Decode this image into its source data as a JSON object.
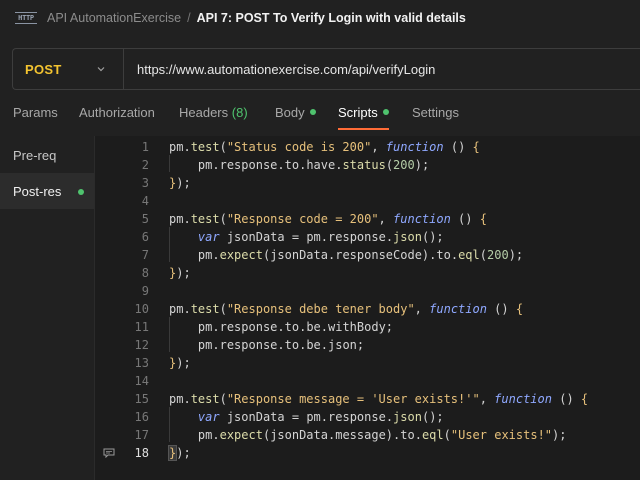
{
  "header": {
    "http_icon_text": "HTTP",
    "collection_name": "API AutomationExercise",
    "separator": "/",
    "request_name": "API 7: POST To Verify Login with valid details"
  },
  "request": {
    "method": "POST",
    "url": "https://www.automationexercise.com/api/verifyLogin"
  },
  "tabs": [
    {
      "label": "Params"
    },
    {
      "label": "Authorization"
    },
    {
      "label": "Headers",
      "count": "(8)"
    },
    {
      "label": "Body"
    },
    {
      "label": "Scripts"
    },
    {
      "label": "Settings"
    }
  ],
  "active_tab": "Scripts",
  "scripts_panel": {
    "items": [
      {
        "label": "Pre-req"
      },
      {
        "label": "Post-res"
      }
    ],
    "active": "Post-res"
  },
  "editor": {
    "current_line": 18,
    "line_numbers": [
      "1",
      "2",
      "3",
      "4",
      "5",
      "6",
      "7",
      "8",
      "9",
      "10",
      "11",
      "12",
      "13",
      "14",
      "15",
      "16",
      "17",
      "18"
    ],
    "lines": [
      "pm.test(\"Status code is 200\", function () {",
      "    pm.response.to.have.status(200);",
      "});",
      "",
      "pm.test(\"Response code = 200\", function () {",
      "    var jsonData = pm.response.json();",
      "    pm.expect(jsonData.responseCode).to.eql(200);",
      "});",
      "",
      "pm.test(\"Response debe tener body\", function () {",
      "    pm.response.to.be.withBody;",
      "    pm.response.to.be.json;",
      "});",
      "",
      "pm.test(\"Response message = 'User exists!'\", function () {",
      "    var jsonData = pm.response.json();",
      "    pm.expect(jsonData.message).to.eql(\"User exists!\");",
      "});"
    ]
  },
  "colors": {
    "accent": "#ff6c37",
    "method_post": "#f4c430",
    "status_dot": "#4fc36e"
  },
  "icons": {
    "method_dropdown": "chevron-down-icon",
    "gutter": "comment-icon",
    "logo": "http-icon"
  }
}
